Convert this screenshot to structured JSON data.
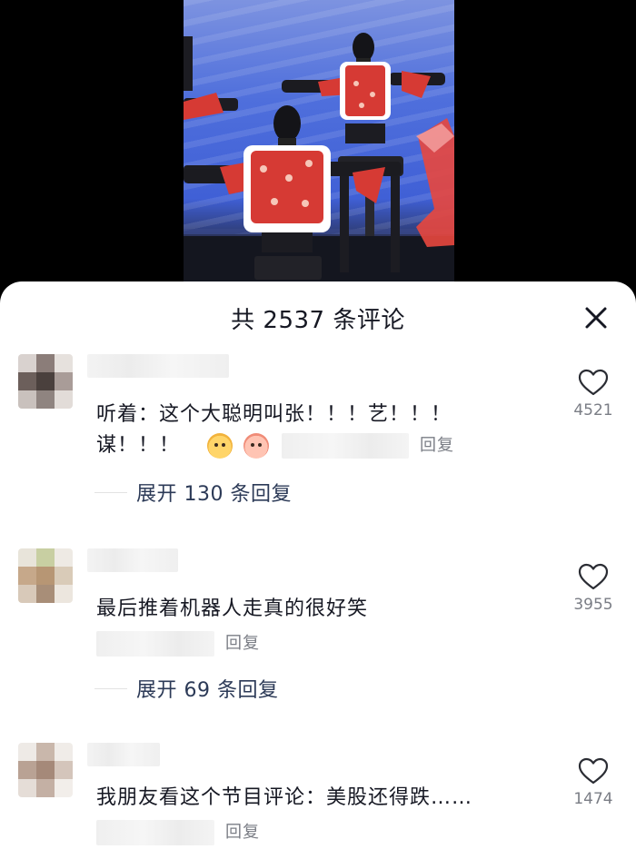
{
  "video": {
    "icon": "video-frame-robots-dancing",
    "colors": {
      "backdrop": "#4f6fdc",
      "vest": "#d63a34",
      "fur": "#ffffff"
    }
  },
  "sheet": {
    "title": "共 2537 条评论",
    "close_icon": "close-icon"
  },
  "comments": [
    {
      "text_line1": "听着：这个大聪明叫张！！！艺！！！",
      "text_line2": "谋！！！",
      "emojis": [
        "emoji-dog-icon",
        "emoji-crying-icon"
      ],
      "reply_label": "回复",
      "likes": "4521",
      "expand_label": "展开 130 条回复"
    },
    {
      "text": "最后推着机器人走真的很好笑",
      "reply_label": "回复",
      "likes": "3955",
      "expand_label": "展开 69 条回复"
    },
    {
      "text": "我朋友看这个节目评论：美股还得跌……",
      "reply_label": "回复",
      "likes": "1474"
    }
  ]
}
